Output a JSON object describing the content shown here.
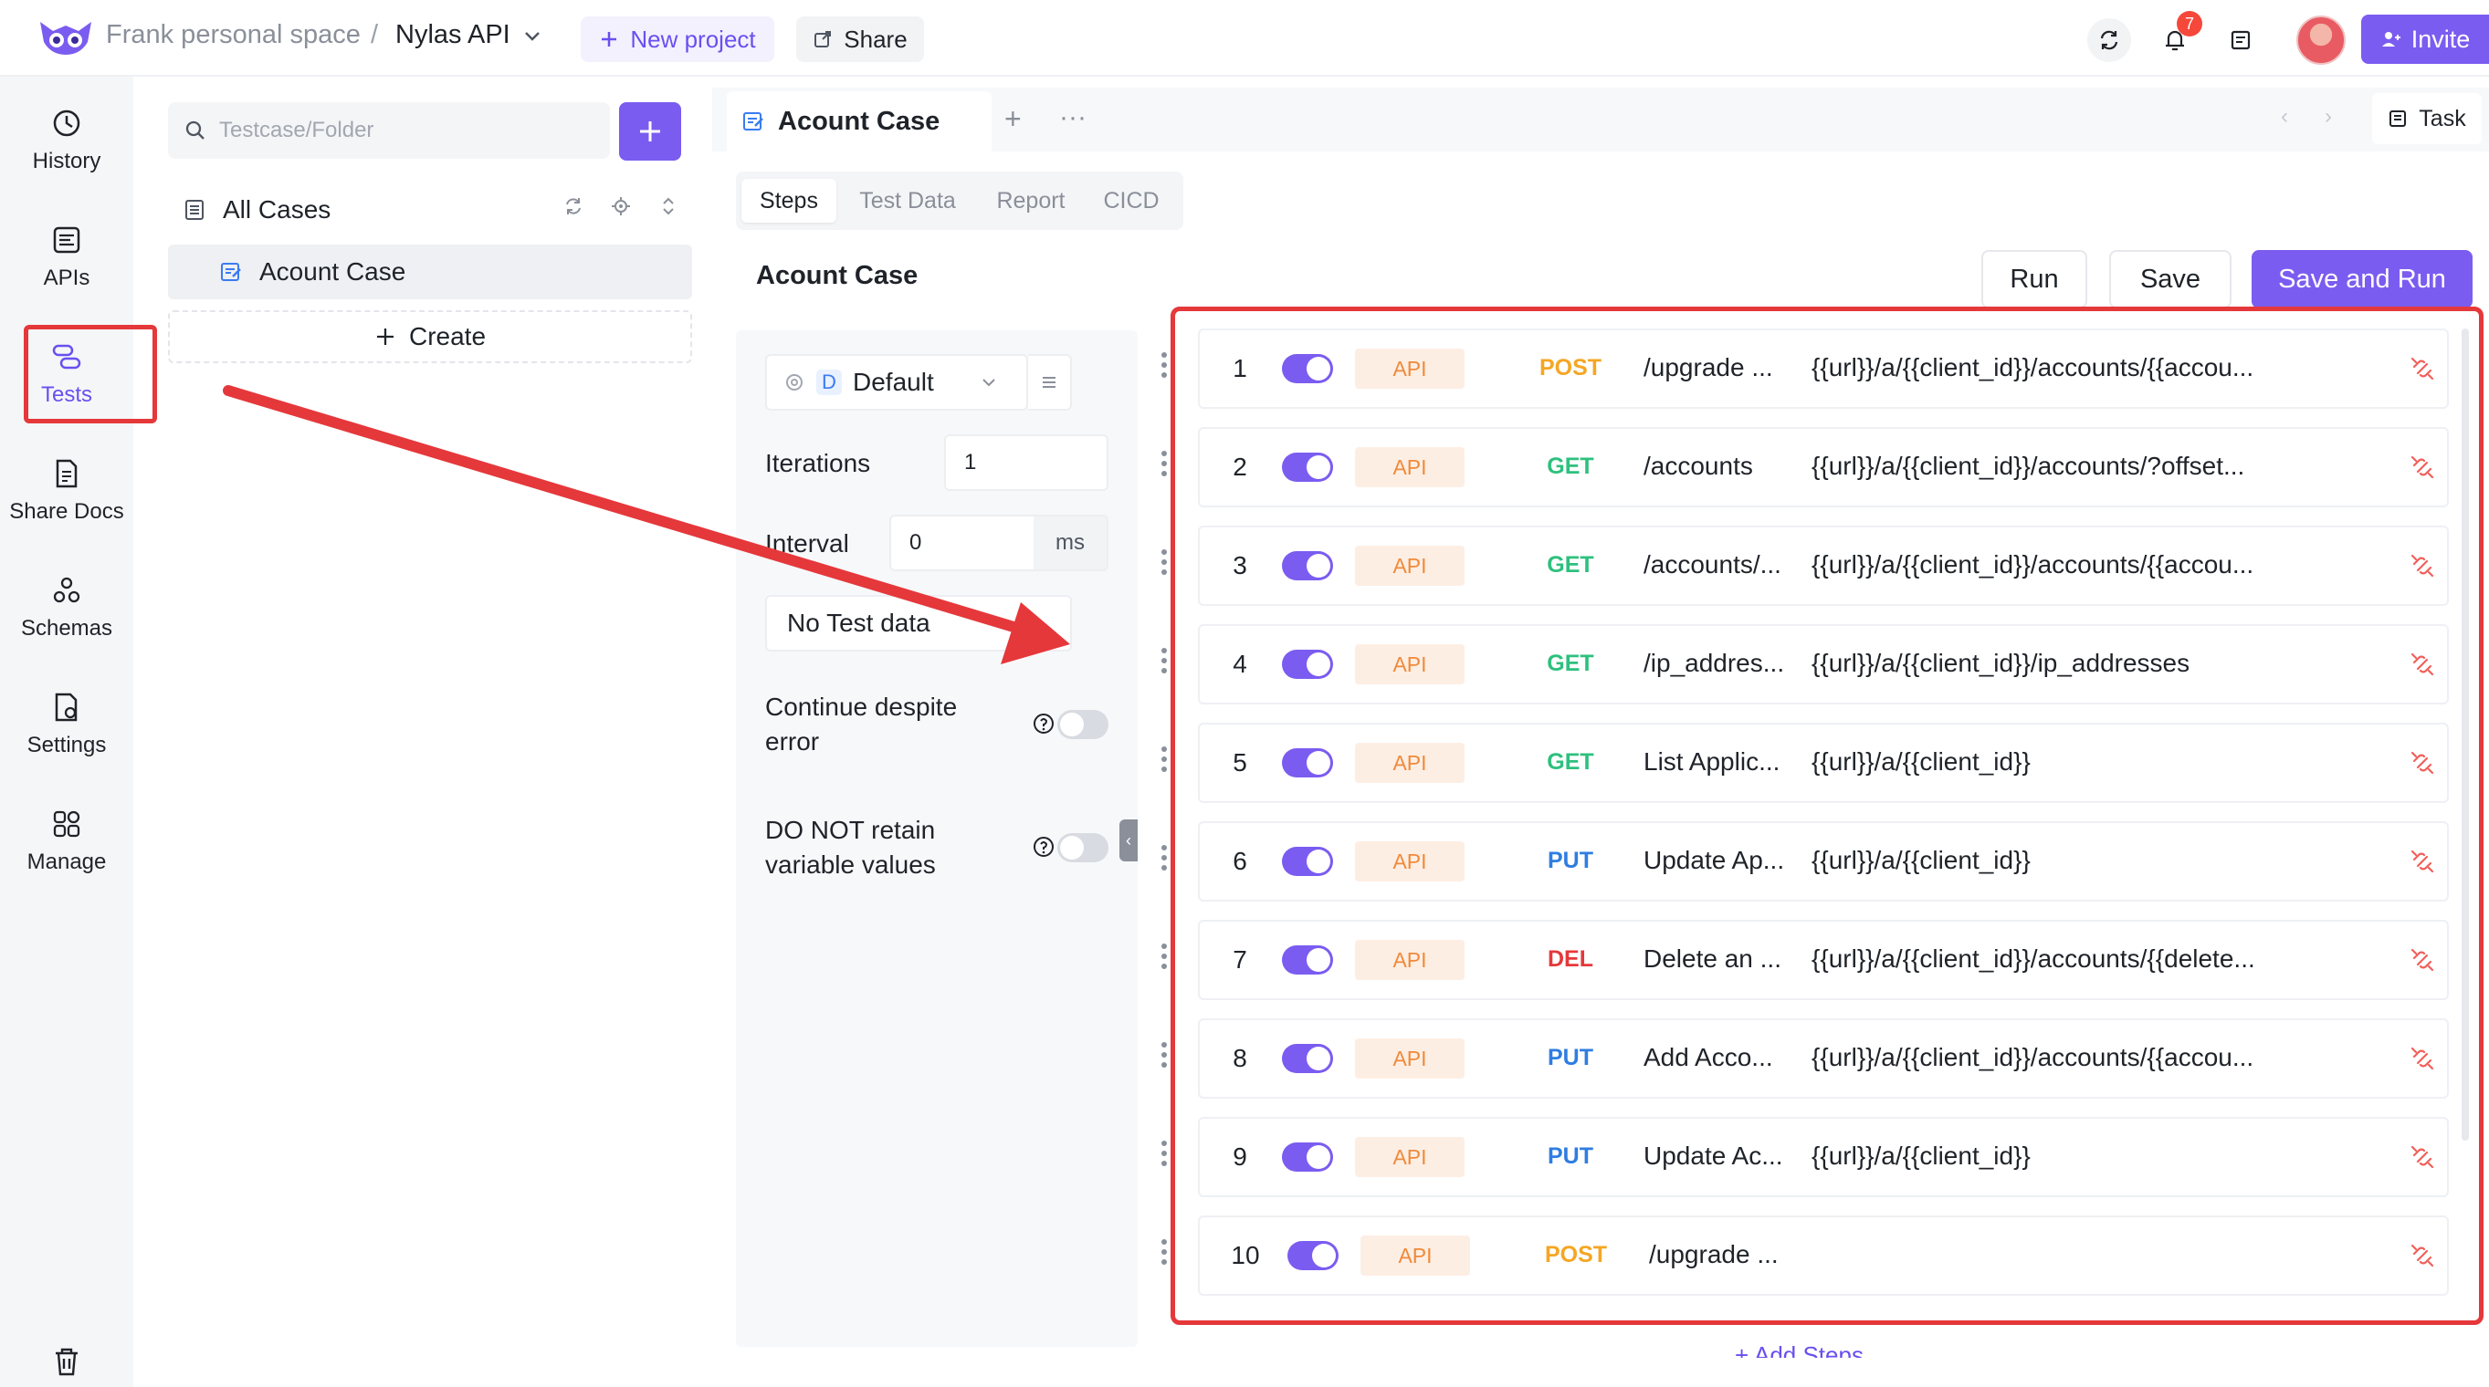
{
  "header": {
    "space": "Frank personal space",
    "separator": "/",
    "project": "Nylas API",
    "new_project": "New project",
    "share": "Share",
    "notification_count": "7",
    "invite": "Invite"
  },
  "rail": {
    "items": [
      {
        "label": "History",
        "icon": "history-icon"
      },
      {
        "label": "APIs",
        "icon": "apis-icon"
      },
      {
        "label": "Tests",
        "icon": "tests-icon"
      },
      {
        "label": "Share Docs",
        "icon": "share-docs-icon"
      },
      {
        "label": "Schemas",
        "icon": "schemas-icon"
      },
      {
        "label": "Settings",
        "icon": "settings-icon"
      },
      {
        "label": "Manage",
        "icon": "manage-icon"
      }
    ],
    "active": "Tests"
  },
  "tree": {
    "search_placeholder": "Testcase/Folder",
    "all_cases": "All Cases",
    "case": "Acount Case",
    "create": "Create"
  },
  "tabs": {
    "doc_tab": "Acount Case",
    "task": "Task",
    "sub": [
      "Steps",
      "Test Data",
      "Report",
      "CICD"
    ],
    "active_sub": "Steps"
  },
  "main": {
    "title": "Acount Case",
    "run": "Run",
    "save": "Save",
    "save_and_run": "Save and Run"
  },
  "config": {
    "env_badge": "D",
    "env_name": "Default",
    "iterations_label": "Iterations",
    "iterations_value": "1",
    "interval_label": "Interval",
    "interval_value": "0",
    "interval_unit": "ms",
    "test_data": "No Test data",
    "continue_label_1": "Continue despite",
    "continue_label_2": "error",
    "retain_label_1": "DO NOT retain",
    "retain_label_2": "variable values"
  },
  "colors": {
    "accent": "#7b5cf0",
    "highlight": "#e5383b",
    "post": "#f5a623",
    "get": "#2ec07e",
    "put": "#2f7de1",
    "del": "#e5383b"
  },
  "steps": [
    {
      "num": "1",
      "type": "API",
      "method": "POST",
      "name": "/upgrade ...",
      "url": "{{url}}/a/{{client_id}}/accounts/{{accou..."
    },
    {
      "num": "2",
      "type": "API",
      "method": "GET",
      "name": "/accounts",
      "url": "{{url}}/a/{{client_id}}/accounts/?offset..."
    },
    {
      "num": "3",
      "type": "API",
      "method": "GET",
      "name": "/accounts/...",
      "url": "{{url}}/a/{{client_id}}/accounts/{{accou..."
    },
    {
      "num": "4",
      "type": "API",
      "method": "GET",
      "name": "/ip_addres...",
      "url": "{{url}}/a/{{client_id}}/ip_addresses"
    },
    {
      "num": "5",
      "type": "API",
      "method": "GET",
      "name": "List Applic...",
      "url": "{{url}}/a/{{client_id}}"
    },
    {
      "num": "6",
      "type": "API",
      "method": "PUT",
      "name": "Update Ap...",
      "url": "{{url}}/a/{{client_id}}"
    },
    {
      "num": "7",
      "type": "API",
      "method": "DEL",
      "name": "Delete an ...",
      "url": "{{url}}/a/{{client_id}}/accounts/{{delete..."
    },
    {
      "num": "8",
      "type": "API",
      "method": "PUT",
      "name": "Add Acco...",
      "url": "{{url}}/a/{{client_id}}/accounts/{{accou..."
    },
    {
      "num": "9",
      "type": "API",
      "method": "PUT",
      "name": "Update Ac...",
      "url": "{{url}}/a/{{client_id}}"
    },
    {
      "num": "10",
      "type": "API",
      "method": "POST",
      "name": "/upgrade ...",
      "url": ""
    }
  ],
  "add_steps": "+ Add Steps"
}
